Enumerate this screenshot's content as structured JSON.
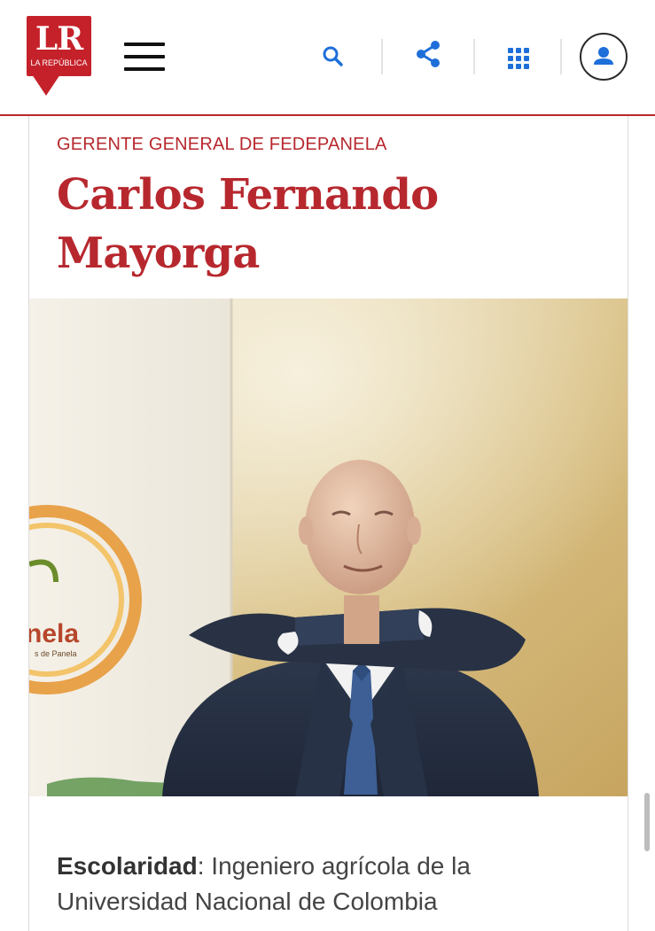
{
  "header": {
    "logo_letters": "LR",
    "logo_subtitle": "LA REPÚBLICA",
    "menu_icon": "hamburger-menu-icon",
    "search_icon": "search-icon",
    "share_icon": "share-icon",
    "apps_icon": "apps-grid-icon",
    "account_icon": "user-account-icon"
  },
  "article": {
    "kicker": "GERENTE GENERAL DE FEDEPANELA",
    "name": "Carlos Fernando Mayorga",
    "photo_banner_text": "nela",
    "photo_banner_small_text": "s de Panela",
    "bio_label": "Escolaridad",
    "bio_text": ": Ingeniero agrícola de la Universidad Nacional de Colombia"
  },
  "colors": {
    "brand_red": "#b7282e",
    "logo_red": "#c5212a",
    "icon_blue": "#1e6fd9"
  }
}
